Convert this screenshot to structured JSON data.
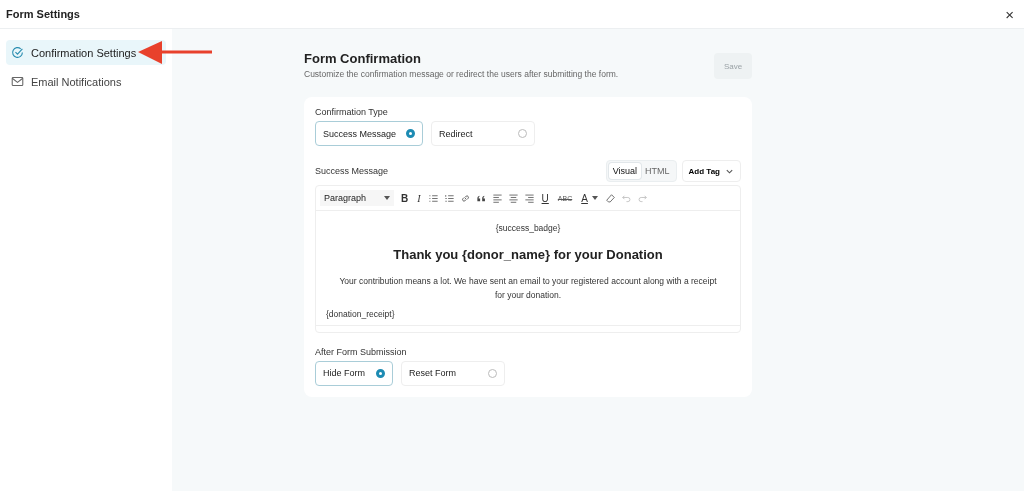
{
  "window": {
    "title": "Form Settings",
    "close": "×"
  },
  "sidebar": {
    "items": [
      {
        "label": "Confirmation Settings",
        "selected": true
      },
      {
        "label": "Email Notifications",
        "selected": false
      }
    ]
  },
  "header": {
    "title": "Form Confirmation",
    "subtitle": "Customize the confirmation message or redirect the users after submitting the form.",
    "save": "Save",
    "save_disabled": true
  },
  "confirmation_type": {
    "label": "Confirmation Type",
    "options": [
      {
        "label": "Success Message",
        "selected": true
      },
      {
        "label": "Redirect",
        "selected": false
      }
    ]
  },
  "editor": {
    "label": "Success Message",
    "modes": [
      {
        "label": "Visual",
        "selected": true
      },
      {
        "label": "HTML",
        "selected": false
      }
    ],
    "add_tag": "Add Tag",
    "toolbar": {
      "format": "Paragraph",
      "bold": "B",
      "italic": "I",
      "underline": "U",
      "strike": "ABC",
      "text_color": "A"
    },
    "content": {
      "badge": "{success_badge}",
      "heading": "Thank you {donor_name} for your Donation",
      "body": "Your contribution means a lot. We have sent an email to your registered account along with a receipt for your donation.",
      "receipt": "{donation_receipt}"
    }
  },
  "after_submission": {
    "label": "After Form Submission",
    "options": [
      {
        "label": "Hide Form",
        "selected": true
      },
      {
        "label": "Reset Form",
        "selected": false
      }
    ]
  }
}
